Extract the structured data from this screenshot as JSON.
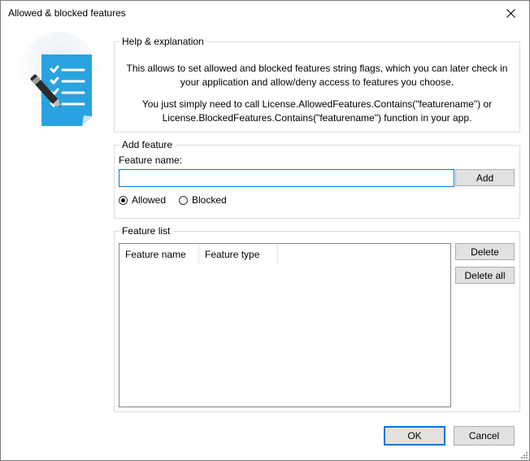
{
  "window": {
    "title": "Allowed & blocked features"
  },
  "illustration": {
    "icon": "checklist-document-with-pen-icon"
  },
  "help": {
    "title": "Help & explanation",
    "line1": "This allows to set allowed and blocked features string flags, which you can later check in your application and allow/deny access to features you choose.",
    "line2": "You just simply need to call License.AllowedFeatures.Contains(\"featurename\") or License.BlockedFeatures.Contains(\"featurename\") function in your app."
  },
  "add_feature": {
    "title": "Add feature",
    "name_label": "Feature name:",
    "name_value": "",
    "add_label": "Add",
    "radio_allowed": "Allowed",
    "radio_blocked": "Blocked",
    "selected": "Allowed"
  },
  "feature_list": {
    "title": "Feature list",
    "columns": [
      "Feature name",
      "Feature type"
    ],
    "rows": [],
    "delete_label": "Delete",
    "delete_all_label": "Delete all"
  },
  "footer": {
    "ok_label": "OK",
    "cancel_label": "Cancel"
  },
  "colors": {
    "focus_accent": "#0078d7",
    "illustration_blue": "#29a3e0"
  }
}
